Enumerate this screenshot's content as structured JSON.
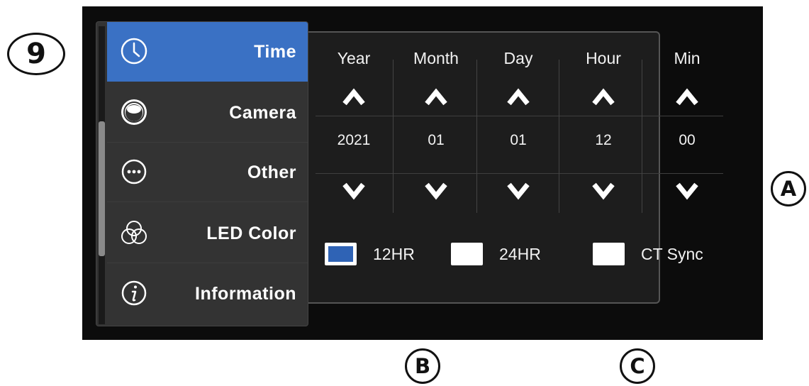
{
  "callouts": {
    "step": "9",
    "a": "A",
    "b": "B",
    "c": "C"
  },
  "menu": {
    "selected": "Time",
    "items": [
      {
        "label": "Time",
        "icon": "clock-icon"
      },
      {
        "label": "Camera",
        "icon": "camera-lens-icon"
      },
      {
        "label": "Other",
        "icon": "more-dots-icon"
      },
      {
        "label": "LED Color",
        "icon": "rgb-circles-icon"
      },
      {
        "label": "Information",
        "icon": "info-icon"
      }
    ]
  },
  "time": {
    "columns": [
      {
        "label": "Year",
        "value": "2021"
      },
      {
        "label": "Month",
        "value": "01"
      },
      {
        "label": "Day",
        "value": "01"
      },
      {
        "label": "Hour",
        "value": "12"
      },
      {
        "label": "Min",
        "value": "00"
      }
    ]
  },
  "format": {
    "options": [
      {
        "label": "12HR",
        "checked": true
      },
      {
        "label": "24HR",
        "checked": false
      },
      {
        "label": "CT Sync",
        "checked": false
      }
    ]
  },
  "colors": {
    "accent": "#3a71c4",
    "screen": "#0c0c0c",
    "panel": "#1d1d1d"
  }
}
